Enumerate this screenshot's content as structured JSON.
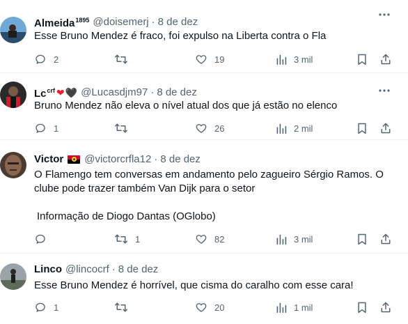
{
  "tweets": [
    {
      "name": "Almeida",
      "name_sup": "1895",
      "handle": "@doisemerj",
      "sep": "·",
      "date": "8 de dez",
      "text": "Esse Bruno Mendez é fraco, foi expulso na Liberta contra o Fla",
      "replies": "2",
      "retweets": "",
      "likes": "19",
      "views": "3 mil"
    },
    {
      "name": "Lc",
      "name_sup": "crf",
      "name_emoji": [
        "❤",
        "🖤"
      ],
      "handle": "@Lucasdjm97",
      "sep": "·",
      "date": "8 de dez",
      "text": "Bruno Mendez não eleva o nível atual dos que já estão no elenco",
      "replies": "1",
      "retweets": "",
      "likes": "26",
      "views": "2 mil"
    },
    {
      "name": "Victor",
      "flag": "angola-flag",
      "handle": "@victorcrfla12",
      "sep": "·",
      "date": "8 de dez",
      "text": "O Flamengo tem conversas em andamento pelo zagueiro Sérgio Ramos. O clube pode trazer também Van Dijk para o setor",
      "text2": "Informação de Diogo Dantas (OGlobo)",
      "replies": "",
      "retweets": "1",
      "likes": "82",
      "views": "3 mil"
    },
    {
      "name": "Linco",
      "handle": "@lincocrf",
      "sep": "·",
      "date": "8 de dez",
      "text": "Esse Bruno Mendez é horrível, que cisma do caralho com esse cara!",
      "replies": "1",
      "retweets": "",
      "likes": "20",
      "views": "1 mil"
    }
  ],
  "icons": {
    "reply": "reply-icon",
    "retweet": "retweet-icon",
    "like": "like-icon",
    "views": "views-icon",
    "bookmark": "bookmark-icon",
    "share": "share-icon",
    "more": "more-icon"
  },
  "colors": {
    "text": "#0f1419",
    "secondary": "#536471",
    "divider": "#eff3f4",
    "heart": "#e8202e"
  }
}
